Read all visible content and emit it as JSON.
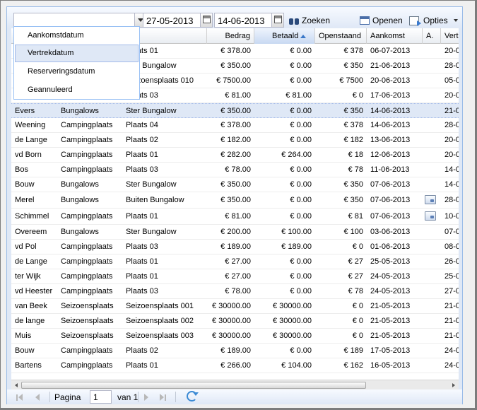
{
  "filter": {
    "date_type_value": "",
    "date_from": "27-05-2013",
    "date_to": "14-06-2013",
    "search_label": "Zoeken",
    "open_label": "Openen",
    "options_label": "Opties"
  },
  "dropdown": {
    "options": [
      "Aankomstdatum",
      "Vertrekdatum",
      "Reserveringsdatum",
      "Geannuleerd"
    ],
    "highlighted": "Vertrekdatum"
  },
  "columns": {
    "naam": "",
    "type": "",
    "locatie": "atie",
    "bedrag": "Bedrag",
    "betaald": "Betaald",
    "openstaand": "Openstaand",
    "aankomst": "Aankomst",
    "a": "A.",
    "vertrek": "Vert"
  },
  "sort": {
    "column": "betaald",
    "direction": "asc",
    "arrow_color": "#3a78c8"
  },
  "rows": [
    {
      "naam": "",
      "type": "",
      "locatie": "Plaats 01",
      "bedrag": "€ 378.00",
      "betaald": "€ 0.00",
      "openstaand": "€ 378",
      "aankomst": "06-07-2013",
      "vertrek": "20-0",
      "action": false
    },
    {
      "naam": "",
      "type": "",
      "locatie": "Ster Bungalow",
      "bedrag": "€ 350.00",
      "betaald": "€ 0.00",
      "openstaand": "€ 350",
      "aankomst": "21-06-2013",
      "vertrek": "28-0",
      "action": false
    },
    {
      "naam": "",
      "type": "",
      "locatie": "Seizoensplaats 010",
      "bedrag": "€ 7500.00",
      "betaald": "€ 0.00",
      "openstaand": "€ 7500",
      "aankomst": "20-06-2013",
      "vertrek": "05-0",
      "action": false
    },
    {
      "naam": "",
      "type": "",
      "locatie": "Plaats 03",
      "bedrag": "€ 81.00",
      "betaald": "€ 81.00",
      "openstaand": "€ 0",
      "aankomst": "17-06-2013",
      "vertrek": "20-0",
      "action": false
    },
    {
      "naam": "Evers",
      "type": "Bungalows",
      "locatie": "Ster Bungalow",
      "bedrag": "€ 350.00",
      "betaald": "€ 0.00",
      "openstaand": "€ 350",
      "aankomst": "14-06-2013",
      "vertrek": "21-0",
      "action": false,
      "selected": true
    },
    {
      "naam": "Weening",
      "type": "Campingplaats",
      "locatie": "Plaats 04",
      "bedrag": "€ 378.00",
      "betaald": "€ 0.00",
      "openstaand": "€ 378",
      "aankomst": "14-06-2013",
      "vertrek": "28-0",
      "action": false
    },
    {
      "naam": "de Lange",
      "type": "Campingplaats",
      "locatie": "Plaats 02",
      "bedrag": "€ 182.00",
      "betaald": "€ 0.00",
      "openstaand": "€ 182",
      "aankomst": "13-06-2013",
      "vertrek": "20-0",
      "action": false
    },
    {
      "naam": "vd Born",
      "type": "Campingplaats",
      "locatie": "Plaats 01",
      "bedrag": "€ 282.00",
      "betaald": "€ 264.00",
      "openstaand": "€ 18",
      "aankomst": "12-06-2013",
      "vertrek": "20-0",
      "action": false
    },
    {
      "naam": "Bos",
      "type": "Campingplaats",
      "locatie": "Plaats 03",
      "bedrag": "€ 78.00",
      "betaald": "€ 0.00",
      "openstaand": "€ 78",
      "aankomst": "11-06-2013",
      "vertrek": "14-0",
      "action": false
    },
    {
      "naam": "Bouw",
      "type": "Bungalows",
      "locatie": "Ster Bungalow",
      "bedrag": "€ 350.00",
      "betaald": "€ 0.00",
      "openstaand": "€ 350",
      "aankomst": "07-06-2013",
      "vertrek": "14-0",
      "action": false
    },
    {
      "naam": "Merel",
      "type": "Bungalows",
      "locatie": "Buiten Bungalow",
      "bedrag": "€ 350.00",
      "betaald": "€ 0.00",
      "openstaand": "€ 350",
      "aankomst": "07-06-2013",
      "vertrek": "28-0",
      "action": true
    },
    {
      "naam": "Schimmel",
      "type": "Campingplaats",
      "locatie": "Plaats 01",
      "bedrag": "€ 81.00",
      "betaald": "€ 0.00",
      "openstaand": "€ 81",
      "aankomst": "07-06-2013",
      "vertrek": "10-0",
      "action": true
    },
    {
      "naam": "Overeem",
      "type": "Bungalows",
      "locatie": "Ster Bungalow",
      "bedrag": "€ 200.00",
      "betaald": "€ 100.00",
      "openstaand": "€ 100",
      "aankomst": "03-06-2013",
      "vertrek": "07-0",
      "action": false
    },
    {
      "naam": "vd Pol",
      "type": "Campingplaats",
      "locatie": "Plaats 03",
      "bedrag": "€ 189.00",
      "betaald": "€ 189.00",
      "openstaand": "€ 0",
      "aankomst": "01-06-2013",
      "vertrek": "08-0",
      "action": false
    },
    {
      "naam": "de Lange",
      "type": "Campingplaats",
      "locatie": "Plaats 01",
      "bedrag": "€ 27.00",
      "betaald": "€ 0.00",
      "openstaand": "€ 27",
      "aankomst": "25-05-2013",
      "vertrek": "26-0",
      "action": false
    },
    {
      "naam": "ter Wijk",
      "type": "Campingplaats",
      "locatie": "Plaats 01",
      "bedrag": "€ 27.00",
      "betaald": "€ 0.00",
      "openstaand": "€ 27",
      "aankomst": "24-05-2013",
      "vertrek": "25-0",
      "action": false
    },
    {
      "naam": "vd Heester",
      "type": "Campingplaats",
      "locatie": "Plaats 03",
      "bedrag": "€ 78.00",
      "betaald": "€ 0.00",
      "openstaand": "€ 78",
      "aankomst": "24-05-2013",
      "vertrek": "27-0",
      "action": false
    },
    {
      "naam": "van Beek",
      "type": "Seizoensplaats",
      "locatie": "Seizoensplaats 001",
      "bedrag": "€ 30000.00",
      "betaald": "€ 30000.00",
      "openstaand": "€ 0",
      "aankomst": "21-05-2013",
      "vertrek": "21-0",
      "action": false
    },
    {
      "naam": "de lange",
      "type": "Seizoensplaats",
      "locatie": "Seizoensplaats 002",
      "bedrag": "€ 30000.00",
      "betaald": "€ 30000.00",
      "openstaand": "€ 0",
      "aankomst": "21-05-2013",
      "vertrek": "21-0",
      "action": false
    },
    {
      "naam": "Muis",
      "type": "Seizoensplaats",
      "locatie": "Seizoensplaats 003",
      "bedrag": "€ 30000.00",
      "betaald": "€ 30000.00",
      "openstaand": "€ 0",
      "aankomst": "21-05-2013",
      "vertrek": "21-0",
      "action": false
    },
    {
      "naam": "Bouw",
      "type": "Campingplaats",
      "locatie": "Plaats 02",
      "bedrag": "€ 189.00",
      "betaald": "€ 0.00",
      "openstaand": "€ 189",
      "aankomst": "17-05-2013",
      "vertrek": "24-0",
      "action": false
    },
    {
      "naam": "Bartens",
      "type": "Campingplaats",
      "locatie": "Plaats 01",
      "bedrag": "€ 266.00",
      "betaald": "€ 104.00",
      "openstaand": "€ 162",
      "aankomst": "16-05-2013",
      "vertrek": "24-0",
      "action": false
    }
  ],
  "pager": {
    "page_label": "Pagina",
    "page_value": "1",
    "of_label": "van 1"
  },
  "icons": {
    "search": "binoculars-icon",
    "open": "open-window-icon",
    "options": "options-icon",
    "calendar": "calendar-icon",
    "refresh": "refresh-icon",
    "row_action": "window-action-icon"
  },
  "colors": {
    "panel_border": "#99bbe8",
    "selected_row": "#dfe8f6",
    "toolbar_bg": "#dfe8f6"
  }
}
